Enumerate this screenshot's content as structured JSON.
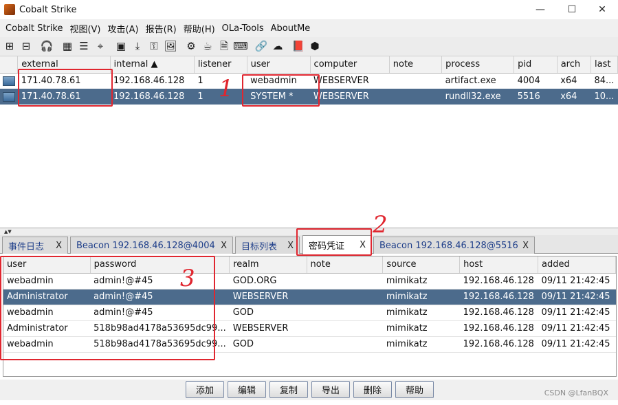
{
  "window": {
    "title": "Cobalt Strike",
    "minimize": "—",
    "maximize": "☐",
    "close": "✕"
  },
  "menu": [
    "Cobalt Strike",
    "视图(V)",
    "攻击(A)",
    "报告(R)",
    "帮助(H)",
    "OLa-Tools",
    "AboutMe"
  ],
  "toolbar": [
    {
      "name": "plus-icon",
      "glyph": "⊞"
    },
    {
      "name": "minus-icon",
      "glyph": "⊟"
    },
    {
      "sep": true
    },
    {
      "name": "headphones-icon",
      "glyph": "🎧"
    },
    {
      "sep": true
    },
    {
      "name": "pivot-graph-icon",
      "glyph": "▦"
    },
    {
      "name": "list-icon",
      "glyph": "☰"
    },
    {
      "name": "target-icon",
      "glyph": "⌖"
    },
    {
      "sep": true
    },
    {
      "name": "credentials-icon",
      "glyph": "▣"
    },
    {
      "name": "download-icon",
      "glyph": "⤓"
    },
    {
      "name": "key-icon",
      "glyph": "⚿"
    },
    {
      "name": "image-icon",
      "glyph": "🖼"
    },
    {
      "sep": true
    },
    {
      "name": "gear-icon",
      "glyph": "⚙"
    },
    {
      "name": "coffee-icon",
      "glyph": "☕"
    },
    {
      "name": "document-icon",
      "glyph": "🗎"
    },
    {
      "name": "console-icon",
      "glyph": "⌨"
    },
    {
      "sep": true
    },
    {
      "name": "link-icon",
      "glyph": "🔗"
    },
    {
      "name": "cloud-icon",
      "glyph": "☁"
    },
    {
      "sep": true
    },
    {
      "name": "book-icon",
      "glyph": "📕"
    },
    {
      "name": "cube-icon",
      "glyph": "⬢"
    }
  ],
  "beacons": {
    "columns": [
      "",
      "external",
      "internal ▲",
      "listener",
      "user",
      "computer",
      "note",
      "process",
      "pid",
      "arch",
      "last"
    ],
    "rows": [
      {
        "external": "171.40.78.61",
        "internal": "192.168.46.128",
        "listener": "1",
        "user": "webadmin",
        "computer": "WEBSERVER",
        "note": "",
        "process": "artifact.exe",
        "pid": "4004",
        "arch": "x64",
        "last": "84...",
        "selected": false
      },
      {
        "external": "171.40.78.61",
        "internal": "192.168.46.128",
        "listener": "1",
        "user": "SYSTEM *",
        "computer": "WEBSERVER",
        "note": "",
        "process": "rundll32.exe",
        "pid": "5516",
        "arch": "x64",
        "last": "10...",
        "selected": true
      }
    ]
  },
  "tabs": [
    {
      "label": "事件日志",
      "close": "X"
    },
    {
      "label": "Beacon 192.168.46.128@4004",
      "close": "X"
    },
    {
      "label": "目标列表",
      "close": "X"
    },
    {
      "label": "密码凭证",
      "close": "X",
      "active": true
    },
    {
      "label": "Beacon 192.168.46.128@5516",
      "close": "X"
    }
  ],
  "credentials": {
    "columns": [
      "user",
      "password",
      "realm",
      "note",
      "source",
      "host",
      "added"
    ],
    "rows": [
      {
        "user": "webadmin",
        "password": "admin!@#45",
        "realm": "GOD.ORG",
        "note": "",
        "source": "mimikatz",
        "host": "192.168.46.128",
        "added": "09/11 21:42:45",
        "selected": false
      },
      {
        "user": "Administrator",
        "password": "admin!@#45",
        "realm": "WEBSERVER",
        "note": "",
        "source": "mimikatz",
        "host": "192.168.46.128",
        "added": "09/11 21:42:45",
        "selected": true
      },
      {
        "user": "webadmin",
        "password": "admin!@#45",
        "realm": "GOD",
        "note": "",
        "source": "mimikatz",
        "host": "192.168.46.128",
        "added": "09/11 21:42:45",
        "selected": false
      },
      {
        "user": "Administrator",
        "password": "518b98ad4178a53695dc99...",
        "realm": "WEBSERVER",
        "note": "",
        "source": "mimikatz",
        "host": "192.168.46.128",
        "added": "09/11 21:42:45",
        "selected": false
      },
      {
        "user": "webadmin",
        "password": "518b98ad4178a53695dc99...",
        "realm": "GOD",
        "note": "",
        "source": "mimikatz",
        "host": "192.168.46.128",
        "added": "09/11 21:42:45",
        "selected": false
      }
    ]
  },
  "buttons": [
    "添加",
    "编辑",
    "复制",
    "导出",
    "删除",
    "帮助"
  ],
  "annotations": [
    "1",
    "2",
    "3"
  ],
  "watermark": "CSDN @LfanBQX",
  "colors": {
    "selection": "#4c6b8c",
    "annotation": "#e0262f"
  }
}
